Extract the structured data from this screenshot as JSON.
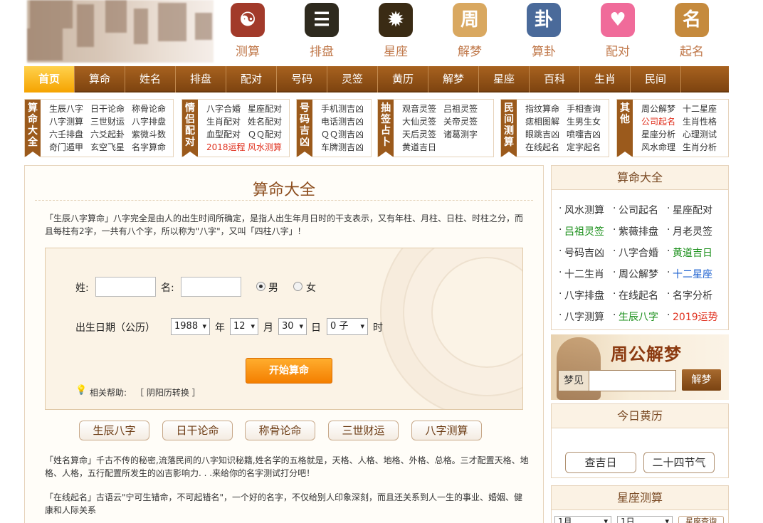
{
  "icons": [
    {
      "name": "yinyang",
      "label": "测算",
      "glyph": "☯",
      "bg": "#a23a2a"
    },
    {
      "name": "bagua-board",
      "label": "排盘",
      "glyph": "☰",
      "bg": "#2e2a1e"
    },
    {
      "name": "zodiac-wheel",
      "label": "星座",
      "glyph": "✹",
      "bg": "#3a2b14"
    },
    {
      "name": "dream-book",
      "label": "解梦",
      "glyph": "周",
      "bg": "#d9a860"
    },
    {
      "name": "fortune-stall",
      "label": "算卦",
      "glyph": "卦",
      "bg": "#4a6a9a"
    },
    {
      "name": "couple",
      "label": "配对",
      "glyph": "♥",
      "bg": "#f06b9a"
    },
    {
      "name": "name-char",
      "label": "起名",
      "glyph": "名",
      "bg": "#c58a3d"
    }
  ],
  "nav": [
    "首页",
    "算命",
    "姓名",
    "排盘",
    "配对",
    "号码",
    "灵签",
    "黄历",
    "解梦",
    "星座",
    "百科",
    "生肖",
    "民间"
  ],
  "groups": [
    {
      "tag": "算命大全",
      "items": [
        "生辰八字",
        "日干论命",
        "称骨论命",
        "八字测算",
        "三世财运",
        "八字排盘",
        "六壬排盘",
        "六爻起卦",
        "紫微斗数",
        "奇门遁甲",
        "玄空飞星",
        "名字算命"
      ]
    },
    {
      "tag": "情侣配对",
      "items": [
        "八字合婚",
        "星座配对",
        "生肖配对",
        "姓名配对",
        "血型配对",
        "ＱＱ配对",
        "2018运程",
        "风水测算"
      ]
    },
    {
      "tag": "号码吉凶",
      "items": [
        "手机测吉凶",
        "电话测吉凶",
        "ＱＱ测吉凶",
        "车牌测吉凶"
      ]
    },
    {
      "tag": "抽签占卜",
      "items": [
        "观音灵签",
        "吕祖灵签",
        "大仙灵签",
        "关帝灵签",
        "天后灵签",
        "诸葛测字",
        "黄道吉日"
      ]
    },
    {
      "tag": "民间测算",
      "items": [
        "指纹算命",
        "手相查询",
        "痣相图解",
        "生男生女",
        "眼跳吉凶",
        "喷嚏吉凶",
        "在线起名",
        "定字起名"
      ]
    },
    {
      "tag": "其他",
      "items": [
        "周公解梦",
        "十二星座",
        "公司起名",
        "生肖性格",
        "星座分析",
        "心理测试",
        "风水命理",
        "生肖分析"
      ]
    }
  ],
  "main": {
    "title": "算命大全",
    "intro1": "「生辰八字算命」八字完全是由人的出生时间所确定，是指人出生年月日时的干支表示，又有年柱、月柱、日柱、时柱之分，而且每柱有2字，一共有八个字，所以称为\"八字\"，又叫「四柱八字」！",
    "form": {
      "surname_label": "姓:",
      "name_label": "名:",
      "male": "男",
      "female": "女",
      "birth_label": "出生日期（公历）",
      "year": "1988",
      "year_unit": "年",
      "month": "12",
      "month_unit": "月",
      "day": "30",
      "day_unit": "日",
      "hour": "0 子",
      "hour_unit": "时",
      "submit": "开始算命",
      "help_label": "相关帮助:",
      "help_link": "［ 阴阳历转换 ］"
    },
    "pills": [
      "生辰八字",
      "日干论命",
      "称骨论命",
      "三世财运",
      "八字测算"
    ],
    "intro2": "「姓名算命」千古不传的秘密,流落民间的八字知识秘籍,姓名学的五格就是，天格、人格、地格、外格、总格。三才配置天格、地格、人格，五行配置所发生的凶吉影响力. . .来给你的名字测试打分吧！",
    "intro3": "「在线起名」古语云\"宁可生错命，不可起错名\"，一个好的名字，不仅给别人印象深刻，而且还关系到人一生的事业、婚姻、健康和人际关系"
  },
  "side": {
    "box1_title": "算命大全",
    "links": [
      {
        "t": "风水测算",
        "c": ""
      },
      {
        "t": "公司起名",
        "c": ""
      },
      {
        "t": "星座配对",
        "c": ""
      },
      {
        "t": "吕祖灵签",
        "c": "green"
      },
      {
        "t": "紫薇排盘",
        "c": ""
      },
      {
        "t": "月老灵签",
        "c": ""
      },
      {
        "t": "号码吉凶",
        "c": ""
      },
      {
        "t": "八字合婚",
        "c": ""
      },
      {
        "t": "黄道吉日",
        "c": "green"
      },
      {
        "t": "十二生肖",
        "c": ""
      },
      {
        "t": "周公解梦",
        "c": ""
      },
      {
        "t": "十二星座",
        "c": "blue"
      },
      {
        "t": "八字排盘",
        "c": ""
      },
      {
        "t": "在线起名",
        "c": ""
      },
      {
        "t": "名字分析",
        "c": ""
      },
      {
        "t": "八字测算",
        "c": ""
      },
      {
        "t": "生辰八字",
        "c": "green"
      },
      {
        "t": "2019运势",
        "c": "red"
      }
    ],
    "dream_title": "周公解梦",
    "dream_label": "梦见",
    "dream_btn": "解梦",
    "box2_title": "今日黄历",
    "btn1": "查吉日",
    "btn2": "二十四节气",
    "box3_title": "星座测算",
    "m1": "1月",
    "m2": "1日",
    "query": "星座查询"
  }
}
